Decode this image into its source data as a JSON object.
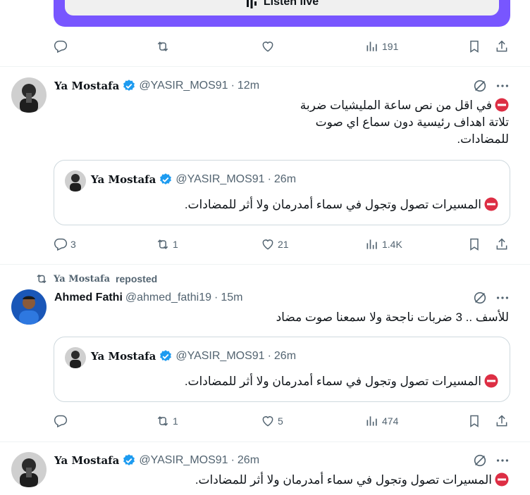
{
  "listen_live": {
    "label": "Listen live",
    "bg_color": "#7856ff"
  },
  "top_actions": {
    "views": "191"
  },
  "tweets": [
    {
      "author": "Ya Mostafa",
      "handle": "@YASIR_MOS91",
      "dot": "·",
      "time": "12m",
      "verified": true,
      "lines": [
        "في اقل من نص ساعة المليشيات ضربة",
        "تلاتة اهداف رئيسية دون سماع اي صوت",
        "للمضادات."
      ],
      "quote": {
        "author": "Ya Mostafa",
        "handle": "@YASIR_MOS91",
        "dot": "·",
        "time": "26m",
        "text": "المسيرات تصول وتجول في سماء أمدرمان ولا أثر للمضادات."
      },
      "stats": {
        "replies": "3",
        "reposts": "1",
        "likes": "21",
        "views": "1.4K"
      }
    },
    {
      "repost_by": "Ya Mostafa",
      "repost_label": "reposted",
      "author": "Ahmed Fathi",
      "handle": "@ahmed_fathi19",
      "dot": "·",
      "time": "15m",
      "text": "للأسف .. 3 ضربات ناجحة ولا سمعنا صوت مضاد",
      "quote": {
        "author": "Ya Mostafa",
        "handle": "@YASIR_MOS91",
        "dot": "·",
        "time": "26m",
        "text": "المسيرات تصول وتجول في سماء أمدرمان ولا أثر للمضادات."
      },
      "stats": {
        "replies": "",
        "reposts": "1",
        "likes": "5",
        "views": "474"
      }
    },
    {
      "author": "Ya Mostafa",
      "handle": "@YASIR_MOS91",
      "dot": "·",
      "time": "26m",
      "verified": true,
      "text": "المسيرات تصول وتجول في سماء أمدرمان ولا أثر للمضادات."
    }
  ],
  "colors": {
    "verified": "#1d9bf0",
    "muted": "#536471",
    "border": "#cfd9de",
    "no_entry": "#dd2e44"
  },
  "icons": [
    "reply-icon",
    "repost-icon",
    "like-icon",
    "views-icon",
    "bookmark-icon",
    "share-icon",
    "grok-icon",
    "more-icon",
    "verified-icon",
    "no-entry-icon",
    "audio-bars-icon"
  ]
}
